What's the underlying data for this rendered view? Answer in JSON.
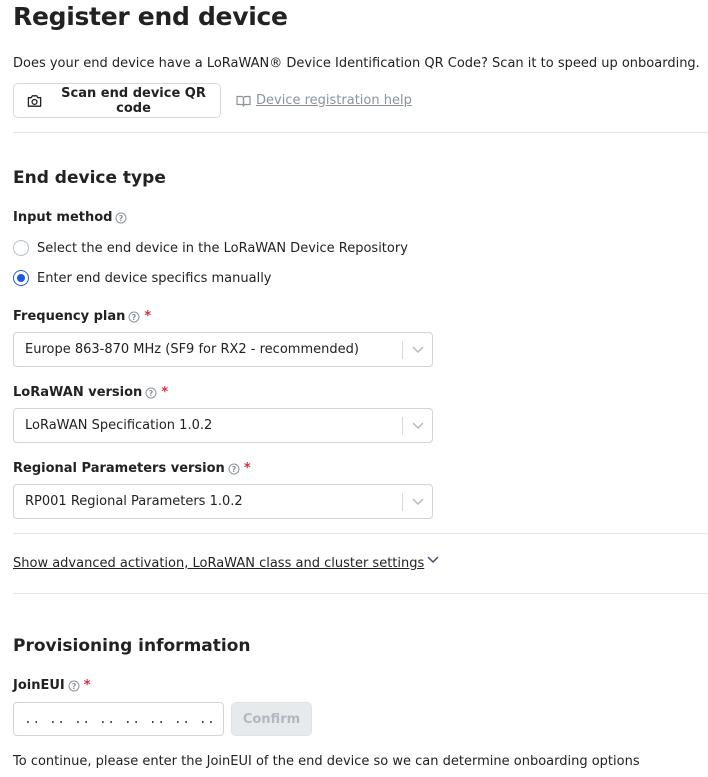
{
  "page": {
    "title": "Register end device"
  },
  "intro": {
    "text": "Does your end device have a LoRaWAN® Device Identification QR Code? Scan it to speed up onboarding."
  },
  "actions": {
    "scan_label": "Scan end device QR code",
    "help_label": "Device registration help"
  },
  "end_device_type": {
    "title": "End device type",
    "input_method": {
      "label": "Input method",
      "options": [
        {
          "label": "Select the end device in the LoRaWAN Device Repository",
          "checked": false
        },
        {
          "label": "Enter end device specifics manually",
          "checked": true
        }
      ]
    },
    "frequency_plan": {
      "label": "Frequency plan",
      "required": "*",
      "value": "Europe 863-870 MHz (SF9 for RX2 - recommended)"
    },
    "lorawan_version": {
      "label": "LoRaWAN version",
      "required": "*",
      "value": "LoRaWAN Specification 1.0.2"
    },
    "regional_parameters": {
      "label": "Regional Parameters version",
      "required": "*",
      "value": "RP001 Regional Parameters 1.0.2"
    },
    "advanced_link": "Show advanced activation, LoRaWAN class and cluster settings"
  },
  "provisioning": {
    "title": "Provisioning information",
    "join_eui": {
      "label": "JoinEUI",
      "required": "*",
      "placeholder": ".. .. .. .. .. .. .. .."
    },
    "confirm_label": "Confirm",
    "note": "To continue, please enter the JoinEUI of the end device so we can determine onboarding options"
  },
  "colors": {
    "accent": "#1b5ae0",
    "required": "#db2c3a",
    "muted": "#8a939c",
    "border": "#cfd4d9"
  }
}
